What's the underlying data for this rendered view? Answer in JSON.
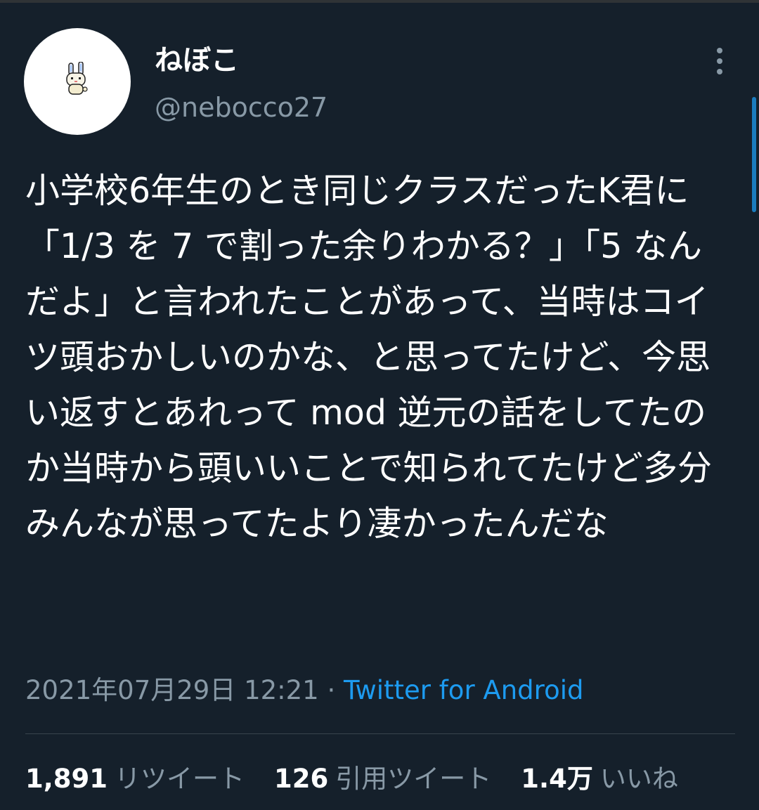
{
  "user": {
    "display_name": "ねぼこ",
    "handle": "@nebocco27"
  },
  "tweet": {
    "text": "小学校6年生のとき同じクラスだったK君に「1/3 を 7 で割った余りわかる？」「5 なんだよ」と言われたことがあって、当時はコイツ頭おかしいのかな、と思ってたけど、今思い返すとあれって mod 逆元の話をしてたのか当時から頭いいことで知られてたけど多分みんなが思ってたより凄かったんだな",
    "timestamp": "2021年07月29日 12:21",
    "separator": " · ",
    "source": "Twitter for Android"
  },
  "stats": {
    "retweets": {
      "count": "1,891",
      "label": "リツイート"
    },
    "quotes": {
      "count": "126",
      "label": "引用ツイート"
    },
    "likes": {
      "count": "1.4万",
      "label": "いいね"
    }
  },
  "icons": {
    "more": "more-vertical-icon",
    "avatar": "bunny-avatar"
  },
  "colors": {
    "background": "#15202b",
    "primary_text": "#ffffff",
    "secondary_text": "#8899a6",
    "accent": "#1d9bf0",
    "divider": "#38444d"
  }
}
